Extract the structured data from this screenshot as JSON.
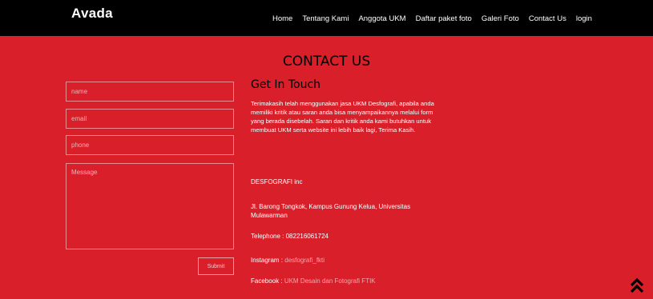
{
  "header": {
    "brand": "Avada",
    "nav": [
      "Home",
      "Tentang Kami",
      "Anggota UKM",
      "Daftar paket foto",
      "Galeri Foto",
      "Contact Us",
      "login"
    ]
  },
  "page": {
    "title": "CONTACT US"
  },
  "form": {
    "name_placeholder": "name",
    "email_placeholder": "email",
    "phone_placeholder": "phone",
    "message_placeholder": "Message",
    "submit_label": "Submit"
  },
  "info": {
    "heading": "Get In Touch",
    "paragraph": "Terimakasih telah menggunakan jasa UKM Desfografi, apabila anda memiliki kritik atau saran anda bisa menyampaikannya melalui form yang berada disebelah. Saran dan kritik anda kami butuhkan untuk membuat UKM serta website ini lebih baik lagi, Terima Kasih.",
    "org": "DESFOGRAFI inc",
    "address": "Jl. Barong Tongkok, Kampus Gunung Kelua, Universitas Mulawarman",
    "telephone": "Telephone : 082216061724",
    "instagram_label": "Instagram :",
    "instagram_value": "desfografi_fkti",
    "facebook_label": "Facebook :",
    "facebook_value": "UKM Desain dan Fotografi FTIK"
  },
  "colors": {
    "background": "#d81f2a",
    "navbar": "#000000",
    "accent": "#f6a6ab"
  },
  "icons": {
    "scroll_top": "double-chevron-up-icon"
  }
}
